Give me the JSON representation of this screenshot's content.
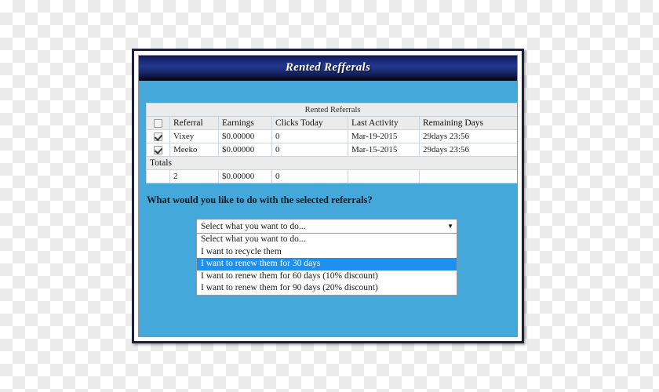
{
  "window": {
    "title": "Rented Refferals"
  },
  "table": {
    "caption": "Rented Referrals",
    "select_all_checkbox": false,
    "columns": [
      {
        "key": "check",
        "label": ""
      },
      {
        "key": "referral",
        "label": "Referral"
      },
      {
        "key": "earnings",
        "label": "Earnings"
      },
      {
        "key": "clicks_today",
        "label": "Clicks Today"
      },
      {
        "key": "last_activity",
        "label": "Last Activity"
      },
      {
        "key": "remaining_days",
        "label": "Remaining Days"
      }
    ],
    "rows": [
      {
        "checked": true,
        "referral": "Vixey",
        "earnings": "$0.00000",
        "clicks_today": "0",
        "last_activity": "Mar-19-2015",
        "remaining_days": "29days 23:56"
      },
      {
        "checked": true,
        "referral": "Meeko",
        "earnings": "$0.00000",
        "clicks_today": "0",
        "last_activity": "Mar-15-2015",
        "remaining_days": "29days 23:56"
      }
    ],
    "totals": {
      "label": "Totals",
      "check": "",
      "referral": "2",
      "earnings": "$0.00000",
      "clicks_today": "0",
      "last_activity": "",
      "remaining_days": ""
    }
  },
  "action_section": {
    "question": "What would you like to do with the selected referrals?",
    "dropdown": {
      "selected_label": "Select what you want to do...",
      "arrow_icon": "chevron-down-icon",
      "expanded": true,
      "options": [
        {
          "label": "Select what you want to do...",
          "highlighted": false
        },
        {
          "label": "I want to recycle them",
          "highlighted": false
        },
        {
          "label": "I want to renew them for 30 days",
          "highlighted": true
        },
        {
          "label": "I want to renew them for 60 days (10% discount)",
          "highlighted": false
        },
        {
          "label": "I want to renew them for 90 days (20% discount)",
          "highlighted": false
        }
      ]
    }
  },
  "colors": {
    "panel_background": "#45a8db",
    "titlebar_dark": "#10194f",
    "titlebar_mid": "#22398f",
    "highlight_blue": "#1e90f0",
    "frame_border": "#1d1f3c",
    "header_gray": "#ebebeb"
  }
}
